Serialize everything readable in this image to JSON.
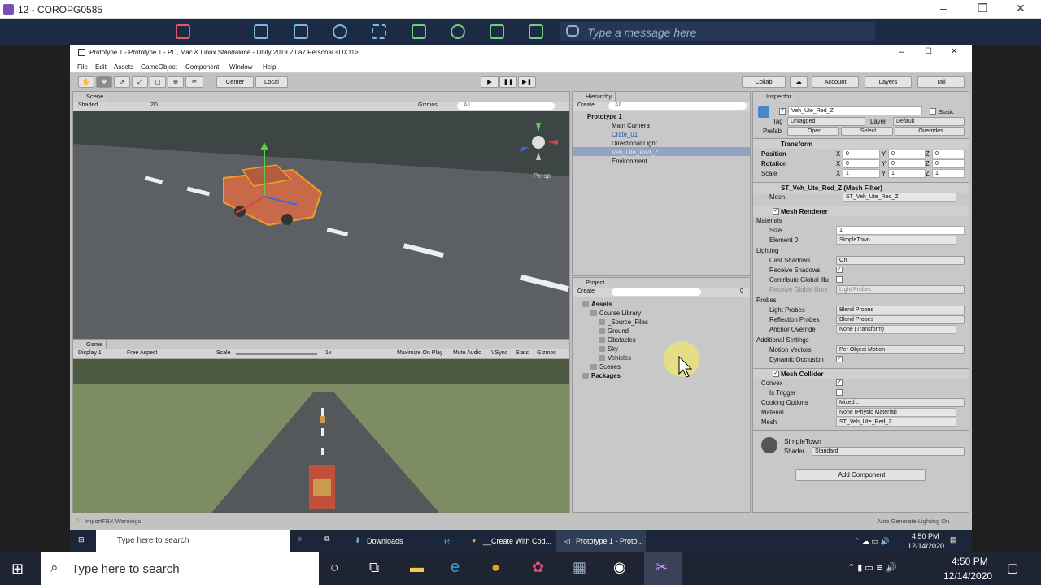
{
  "remote": {
    "title": "12 - COROPG0585",
    "message_placeholder": "Type a message here"
  },
  "unity": {
    "title": "Prototype 1 - Prototype 1 - PC, Mac & Linux Standalone - Unity 2019.2.0a7 Personal <DX11>",
    "menu": [
      "File",
      "Edit",
      "Assets",
      "GameObject",
      "Component",
      "Window",
      "Help"
    ],
    "toolbar": {
      "center": "Center",
      "local": "Local",
      "collab": "Collab",
      "account": "Account",
      "layers": "Layers",
      "layout": "Tall"
    },
    "scene": {
      "tab": "Scene",
      "shading": "Shaded",
      "mode2d": "2D",
      "gizmos": "Gizmos",
      "search": "All",
      "persp": "Persp"
    },
    "game": {
      "tab": "Game",
      "display": "Display 1",
      "aspect": "Free Aspect",
      "scale_label": "Scale",
      "scale_value": "1x",
      "maximize": "Maximize On Play",
      "mute": "Mute Audio",
      "vsync": "VSync",
      "stats": "Stats",
      "gizmos": "Gizmos"
    },
    "status": {
      "warning": "ImportFBX Warnings:",
      "lighting": "Auto Generate Lighting On"
    },
    "hierarchy": {
      "tab": "Hierarchy",
      "create": "Create",
      "search": "All",
      "scene": "Prototype 1",
      "items": [
        "Main Camera",
        "Crate_01",
        "Directional Light",
        "Veh_Ute_Red_Z",
        "Environment"
      ]
    },
    "project": {
      "tab": "Project",
      "create": "Create",
      "count": "0",
      "assets": "Assets",
      "course": "Course Library",
      "folders": [
        "_Source_Files",
        "Ground",
        "Obstacles",
        "Sky",
        "Vehicles"
      ],
      "scenes": "Scenes",
      "packages": "Packages"
    },
    "inspector": {
      "tab": "Inspector",
      "name": "Veh_Ute_Red_Z",
      "static": "Static",
      "tag_label": "Tag",
      "tag": "Untagged",
      "layer_label": "Layer",
      "layer": "Default",
      "prefab_label": "Prefab",
      "open": "Open",
      "select": "Select",
      "overrides": "Overrides",
      "transform": "Transform",
      "position": "Position",
      "rotation": "Rotation",
      "scale": "Scale",
      "pos": [
        "0",
        "0",
        "0"
      ],
      "rot": [
        "0",
        "0",
        "0"
      ],
      "scl": [
        "1",
        "1",
        "1"
      ],
      "mesh_filter": "ST_Veh_Ute_Red_Z (Mesh Filter)",
      "mesh_label": "Mesh",
      "mesh": "ST_Veh_Ute_Red_Z",
      "mesh_renderer": "Mesh Renderer",
      "materials": "Materials",
      "size_label": "Size",
      "size": "1",
      "element0_label": "Element 0",
      "element0": "SimpleTown",
      "lighting": "Lighting",
      "cast_shadows_label": "Cast Shadows",
      "cast_shadows": "On",
      "receive_shadows": "Receive Shadows",
      "contribute_gi": "Contribute Global Illu",
      "receive_gi_label": "Receive Global Illum",
      "receive_gi": "Light Probes",
      "probes": "Probes",
      "light_probes_label": "Light Probes",
      "light_probes": "Blend Probes",
      "reflection_probes_label": "Reflection Probes",
      "reflection_probes": "Blend Probes",
      "anchor_label": "Anchor Override",
      "anchor": "None (Transform)",
      "additional": "Additional Settings",
      "motion_label": "Motion Vectors",
      "motion": "Per Object Motion",
      "dynamic_occlusion": "Dynamic Occlusion",
      "mesh_collider": "Mesh Collider",
      "convex": "Convex",
      "is_trigger": "Is Trigger",
      "cooking_label": "Cooking Options",
      "cooking": "Mixed ...",
      "material_label": "Material",
      "material": "None (Physic Material)",
      "collider_mesh_label": "Mesh",
      "collider_mesh": "ST_Veh_Ute_Red_Z",
      "mat_name": "SimpleTown",
      "shader_label": "Shader",
      "shader": "Standard",
      "add_component": "Add Component"
    }
  },
  "inner_taskbar": {
    "search": "Type here to search",
    "downloads": "Downloads",
    "chrome": "__Create With Cod...",
    "unity": "Prototype 1 - Proto...",
    "time": "4:50 PM",
    "date": "12/14/2020"
  },
  "outer_taskbar": {
    "search": "Type here to search",
    "time": "4:50 PM",
    "date": "12/14/2020"
  }
}
